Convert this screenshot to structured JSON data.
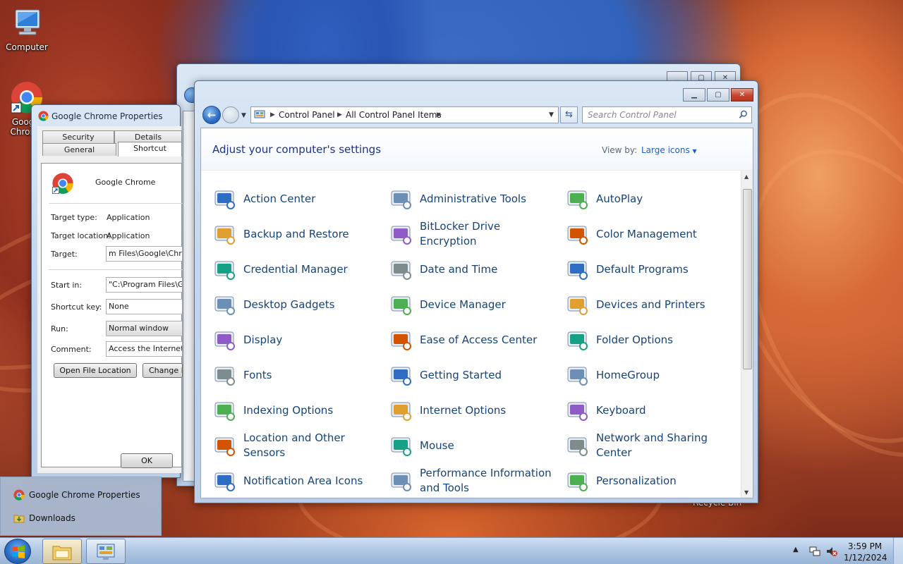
{
  "desktop": {
    "icons": [
      {
        "label": "Computer",
        "icon": "computer-icon"
      },
      {
        "label": "Google Chrome",
        "icon": "chrome-icon"
      }
    ],
    "recycle_bin_label": "Recycle Bin"
  },
  "properties": {
    "title": "Google Chrome Properties",
    "tabs": [
      "Security",
      "Details",
      "General",
      "Shortcut"
    ],
    "active_tab": "Shortcut",
    "app_name": "Google Chrome",
    "target_type_label": "Target type:",
    "target_type_value": "Application",
    "target_location_label": "Target location:",
    "target_location_value": "Application",
    "target_label": "Target:",
    "target_value": "m Files\\Google\\Chrome\\Application\\chrome.exe\"",
    "start_in_label": "Start in:",
    "start_in_value": "\"C:\\Program Files\\Google\\Chrome\\Application\"",
    "shortcut_key_label": "Shortcut key:",
    "shortcut_key_value": "None",
    "run_label": "Run:",
    "run_value": "Normal window",
    "comment_label": "Comment:",
    "comment_value": "Access the Internet",
    "open_file_location": "Open File Location",
    "change_icon": "Change Icon...",
    "ok": "OK"
  },
  "control_panel": {
    "breadcrumb": [
      "Control Panel",
      "All Control Panel Items"
    ],
    "search_placeholder": "Search Control Panel",
    "heading": "Adjust your computer's settings",
    "view_by_label": "View by:",
    "view_by_value": "Large icons",
    "items": [
      {
        "label": "Action Center",
        "icon": "action-center-flag-icon"
      },
      {
        "label": "Administrative Tools",
        "icon": "administrative-tools-icon"
      },
      {
        "label": "AutoPlay",
        "icon": "autoplay-icon"
      },
      {
        "label": "Backup and Restore",
        "icon": "backup-restore-icon"
      },
      {
        "label": "BitLocker Drive Encryption",
        "icon": "bitlocker-key-icon"
      },
      {
        "label": "Color Management",
        "icon": "color-management-icon"
      },
      {
        "label": "Credential Manager",
        "icon": "credential-vault-icon"
      },
      {
        "label": "Date and Time",
        "icon": "date-time-icon"
      },
      {
        "label": "Default Programs",
        "icon": "default-programs-icon"
      },
      {
        "label": "Desktop Gadgets",
        "icon": "desktop-gadgets-icon"
      },
      {
        "label": "Device Manager",
        "icon": "device-manager-icon"
      },
      {
        "label": "Devices and Printers",
        "icon": "devices-printers-icon"
      },
      {
        "label": "Display",
        "icon": "display-monitor-icon"
      },
      {
        "label": "Ease of Access Center",
        "icon": "ease-of-access-icon"
      },
      {
        "label": "Folder Options",
        "icon": "folder-options-icon"
      },
      {
        "label": "Fonts",
        "icon": "fonts-folder-icon"
      },
      {
        "label": "Getting Started",
        "icon": "getting-started-icon"
      },
      {
        "label": "HomeGroup",
        "icon": "homegroup-icon"
      },
      {
        "label": "Indexing Options",
        "icon": "indexing-magnifier-icon"
      },
      {
        "label": "Internet Options",
        "icon": "internet-options-globe-icon"
      },
      {
        "label": "Keyboard",
        "icon": "keyboard-icon"
      },
      {
        "label": "Location and Other Sensors",
        "icon": "location-sensors-icon"
      },
      {
        "label": "Mouse",
        "icon": "mouse-icon"
      },
      {
        "label": "Network and Sharing Center",
        "icon": "network-sharing-icon"
      },
      {
        "label": "Notification Area Icons",
        "icon": "notification-area-icon"
      },
      {
        "label": "Performance Information and Tools",
        "icon": "performance-meter-icon"
      },
      {
        "label": "Personalization",
        "icon": "personalization-icon"
      }
    ]
  },
  "jump_list": {
    "items": [
      {
        "label": "Google Chrome Properties",
        "icon": "chrome-icon"
      },
      {
        "label": "Downloads",
        "icon": "downloads-folder-icon"
      }
    ]
  },
  "taskbar": {
    "time": "3:59 PM",
    "date": "1/12/2024"
  },
  "colors": {
    "link_blue": "#16437a",
    "heading_blue": "#1e3287",
    "close_red": "#c9452f"
  }
}
